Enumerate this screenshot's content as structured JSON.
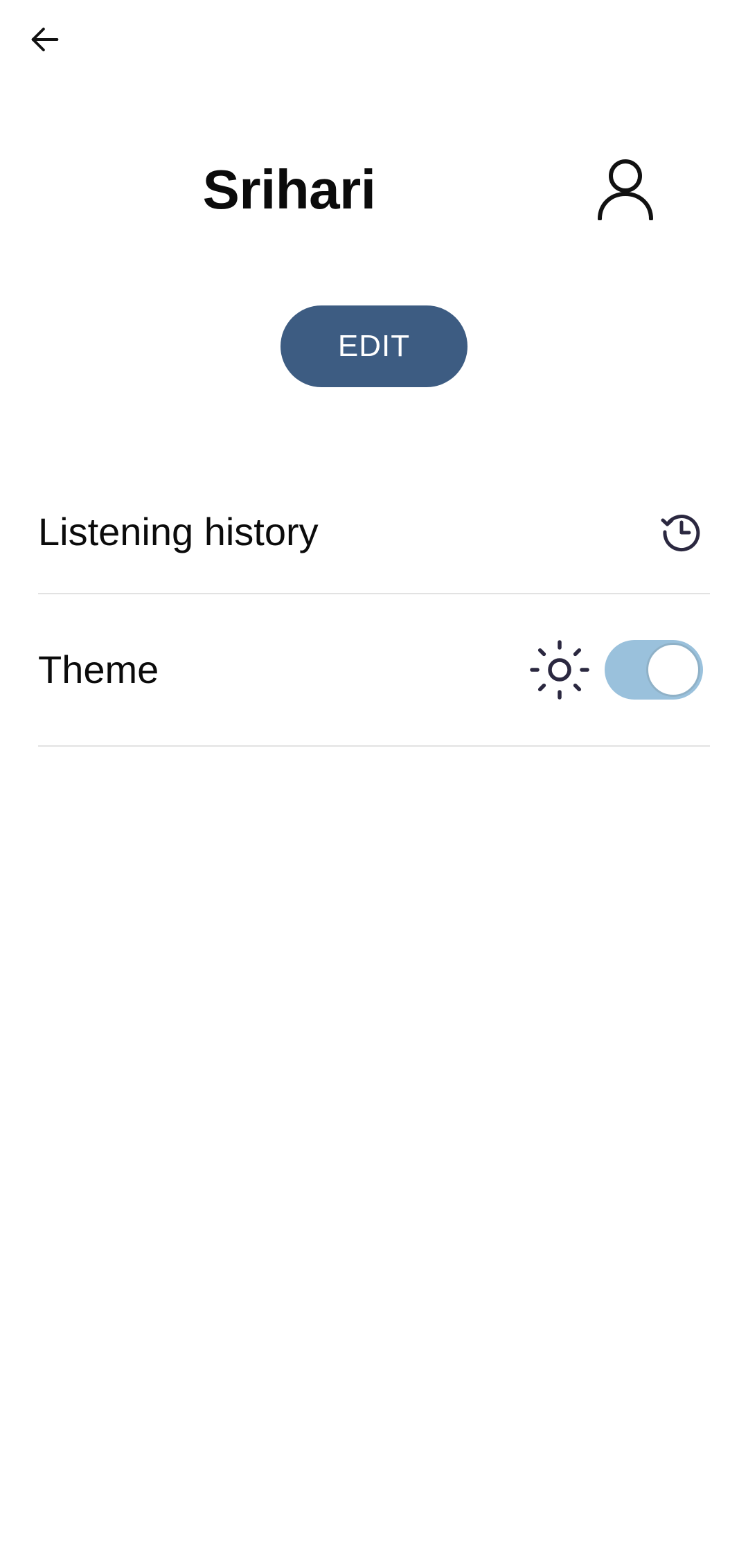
{
  "header": {
    "back_icon": "arrow-left-icon"
  },
  "profile": {
    "username": "Srihari",
    "avatar_icon": "person-outline-icon",
    "edit_label": "EDIT"
  },
  "settings": {
    "listening_history": {
      "label": "Listening history",
      "icon": "history-icon"
    },
    "theme": {
      "label": "Theme",
      "icon": "sun-icon",
      "toggle_on": true
    }
  },
  "colors": {
    "accent": "#3d5c82",
    "toggle_track": "#9ac1dc",
    "divider": "#e2e2e2",
    "icon": "#2b2840"
  }
}
